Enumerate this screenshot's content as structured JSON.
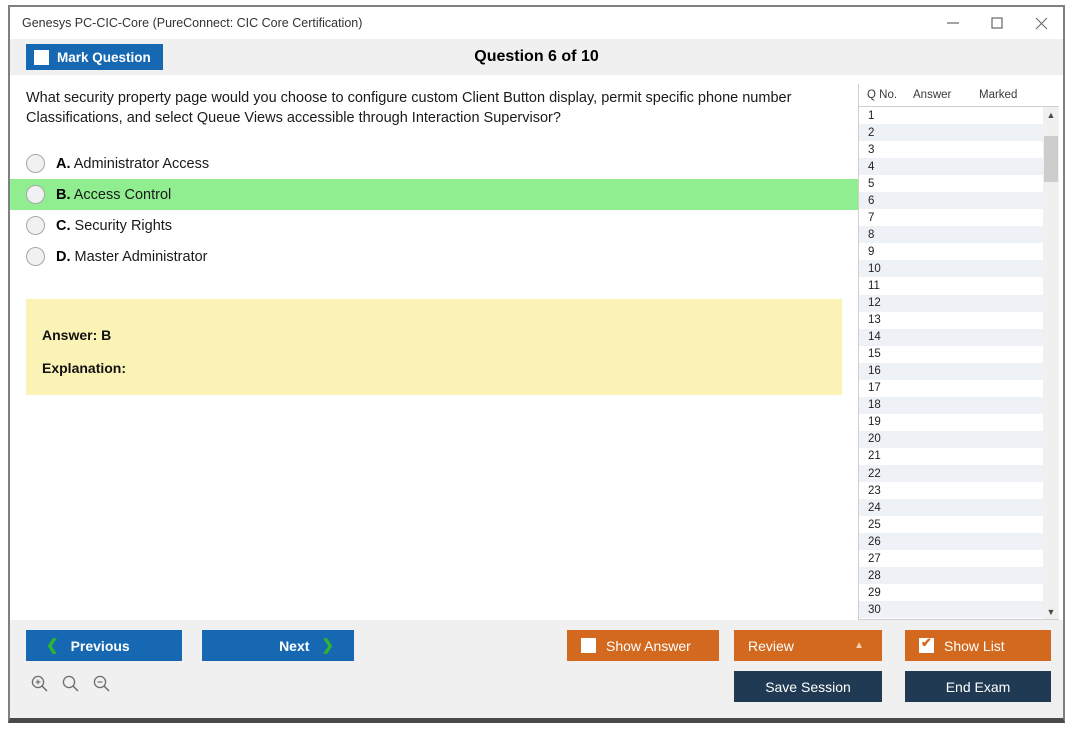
{
  "window": {
    "title": "Genesys PC-CIC-Core (PureConnect: CIC Core Certification)",
    "minimize_icon": "minimize-icon",
    "maximize_icon": "maximize-icon",
    "close_icon": "close-icon"
  },
  "header": {
    "mark_question_label": "Mark Question",
    "mark_question_checked": false,
    "question_title": "Question 6 of 10"
  },
  "question": {
    "text": "What security property page would you choose to configure custom Client Button display, permit specific phone number Classifications, and select Queue Views accessible through Interaction Supervisor?",
    "options": [
      {
        "letter": "A.",
        "text": "Administrator Access",
        "selected": false
      },
      {
        "letter": "B.",
        "text": "Access Control",
        "selected": true
      },
      {
        "letter": "C.",
        "text": "Security Rights",
        "selected": false
      },
      {
        "letter": "D.",
        "text": "Master Administrator",
        "selected": false
      }
    ]
  },
  "answer_box": {
    "answer_label": "Answer: B",
    "explanation_label": "Explanation:"
  },
  "list_panel": {
    "columns": [
      "Q No.",
      "Answer",
      "Marked"
    ],
    "rows": [
      {
        "no": "1",
        "answer": "",
        "marked": ""
      },
      {
        "no": "2",
        "answer": "",
        "marked": ""
      },
      {
        "no": "3",
        "answer": "",
        "marked": ""
      },
      {
        "no": "4",
        "answer": "",
        "marked": ""
      },
      {
        "no": "5",
        "answer": "",
        "marked": ""
      },
      {
        "no": "6",
        "answer": "",
        "marked": ""
      },
      {
        "no": "7",
        "answer": "",
        "marked": ""
      },
      {
        "no": "8",
        "answer": "",
        "marked": ""
      },
      {
        "no": "9",
        "answer": "",
        "marked": ""
      },
      {
        "no": "10",
        "answer": "",
        "marked": ""
      },
      {
        "no": "11",
        "answer": "",
        "marked": ""
      },
      {
        "no": "12",
        "answer": "",
        "marked": ""
      },
      {
        "no": "13",
        "answer": "",
        "marked": ""
      },
      {
        "no": "14",
        "answer": "",
        "marked": ""
      },
      {
        "no": "15",
        "answer": "",
        "marked": ""
      },
      {
        "no": "16",
        "answer": "",
        "marked": ""
      },
      {
        "no": "17",
        "answer": "",
        "marked": ""
      },
      {
        "no": "18",
        "answer": "",
        "marked": ""
      },
      {
        "no": "19",
        "answer": "",
        "marked": ""
      },
      {
        "no": "20",
        "answer": "",
        "marked": ""
      },
      {
        "no": "21",
        "answer": "",
        "marked": ""
      },
      {
        "no": "22",
        "answer": "",
        "marked": ""
      },
      {
        "no": "23",
        "answer": "",
        "marked": ""
      },
      {
        "no": "24",
        "answer": "",
        "marked": ""
      },
      {
        "no": "25",
        "answer": "",
        "marked": ""
      },
      {
        "no": "26",
        "answer": "",
        "marked": ""
      },
      {
        "no": "27",
        "answer": "",
        "marked": ""
      },
      {
        "no": "28",
        "answer": "",
        "marked": ""
      },
      {
        "no": "29",
        "answer": "",
        "marked": ""
      },
      {
        "no": "30",
        "answer": "",
        "marked": ""
      }
    ],
    "scroll_up_icon": "chevron-up-icon",
    "scroll_down_icon": "chevron-down-icon"
  },
  "footer": {
    "previous_label": "Previous",
    "next_label": "Next",
    "show_answer_label": "Show Answer",
    "show_answer_checked": false,
    "review_label": "Review",
    "show_list_label": "Show List",
    "show_list_checked": true,
    "save_session_label": "Save Session",
    "end_exam_label": "End Exam",
    "zoom_in_icon": "zoom-in-icon",
    "zoom_reset_icon": "magnifier-icon",
    "zoom_out_icon": "zoom-out-icon",
    "check_glyph": "✔"
  },
  "colors": {
    "primary_blue": "#1668b3",
    "accent_orange": "#d2691e",
    "navy": "#1f3a52",
    "selected_green": "#90ee90",
    "answer_yellow": "#fbf3b6",
    "chevron_green": "#2fb62f"
  }
}
